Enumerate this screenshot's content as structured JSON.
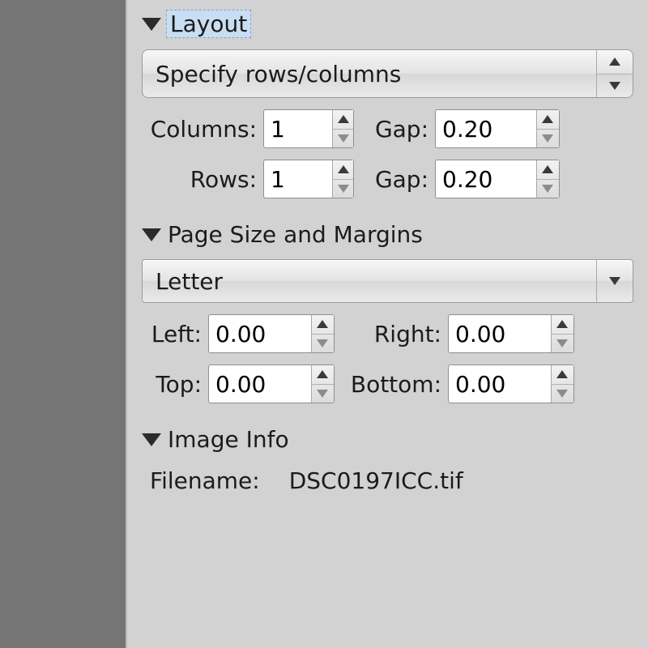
{
  "layout": {
    "header": "Layout",
    "mode": "Specify rows/columns",
    "columns_label": "Columns:",
    "columns": "1",
    "columns_gap_label": "Gap:",
    "columns_gap": "0.20",
    "rows_label": "Rows:",
    "rows": "1",
    "rows_gap_label": "Gap:",
    "rows_gap": "0.20"
  },
  "page": {
    "header": "Page Size and Margins",
    "size": "Letter",
    "left_label": "Left:",
    "left": "0.00",
    "right_label": "Right:",
    "right": "0.00",
    "top_label": "Top:",
    "top": "0.00",
    "bottom_label": "Bottom:",
    "bottom": "0.00"
  },
  "image": {
    "header": "Image Info",
    "filename_label": "Filename:",
    "filename": "DSC0197ICC.tif"
  }
}
